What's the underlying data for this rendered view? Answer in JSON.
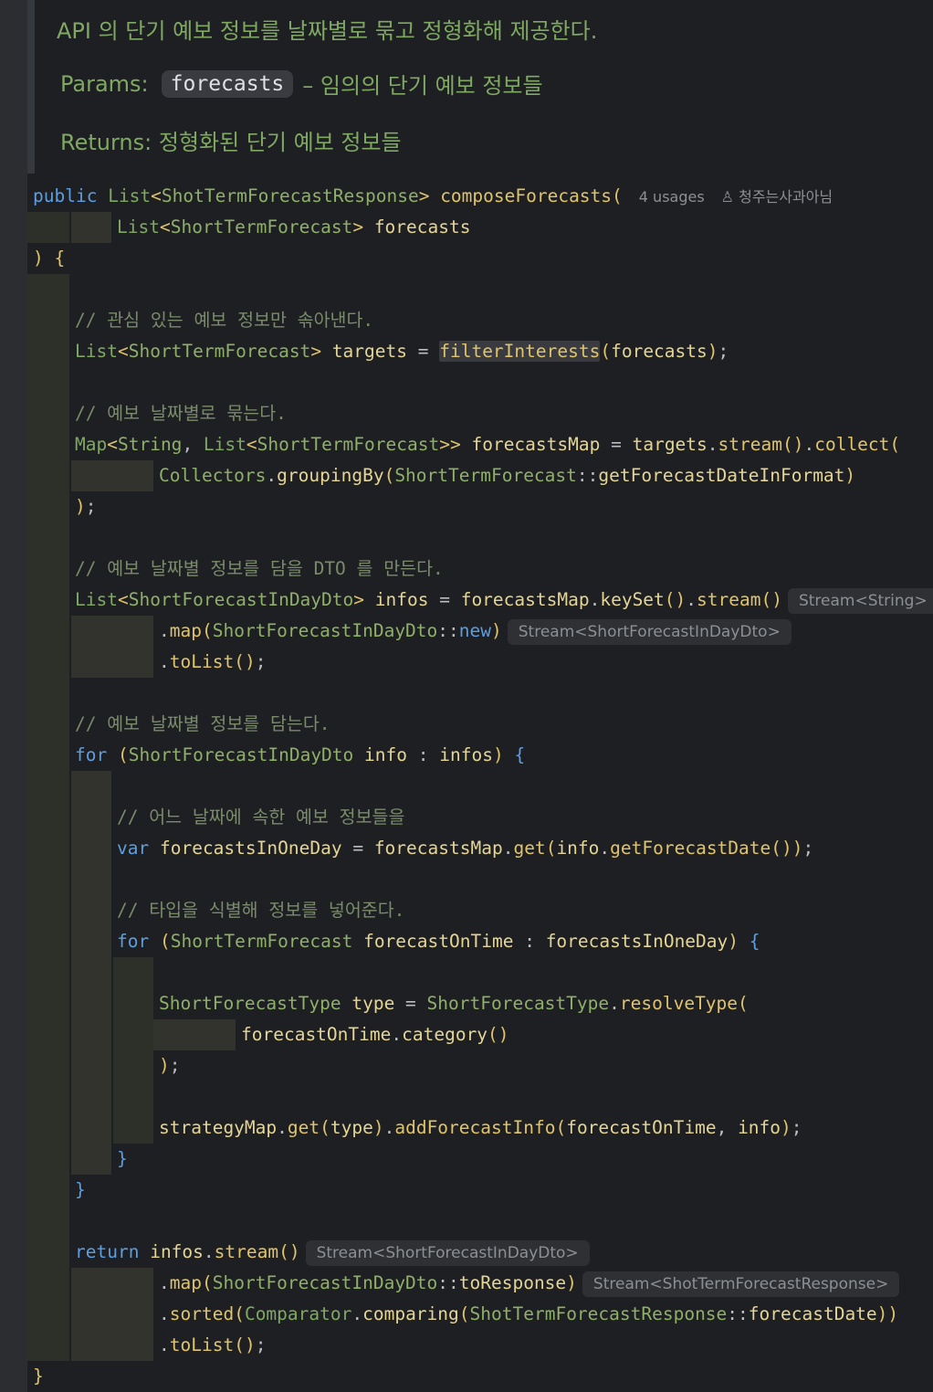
{
  "doc": {
    "summary": "API 의 단기 예보 정보를 날짜별로 묶고 정형화해 제공한다.",
    "params_label": "Params:",
    "param_name": "forecasts",
    "param_desc": "– 임의의 단기 예보 정보들",
    "returns_label": "Returns:",
    "returns_desc": "정형화된 단기 예보 정보들"
  },
  "signature": {
    "modifier": "public",
    "return_list": "List",
    "return_type": "ShotTermForecastResponse",
    "method": "composeForecasts",
    "usages": "4 usages",
    "author": "청주는사과아님",
    "param_list": "List",
    "param_type": "ShortTermForecast",
    "param_name": "forecasts"
  },
  "comments": {
    "c1": "// 관심 있는 예보 정보만 솎아낸다.",
    "c2": "// 예보 날짜별로 묶는다.",
    "c3": "// 예보 날짜별 정보를 담을 DTO 를 만든다.",
    "c4": "// 예보 날짜별 정보를 담는다.",
    "c5": "// 어느 날짜에 속한 예보 정보들을",
    "c6": "// 타입을 식별해 정보를 넣어준다."
  },
  "hints": {
    "stream_string": "Stream<String>",
    "stream_dto": "Stream<ShortForecastInDayDto>",
    "stream_dto2": "Stream<ShortForecastInDayDto>",
    "stream_response": "Stream<ShotTermForecastResponse>"
  }
}
